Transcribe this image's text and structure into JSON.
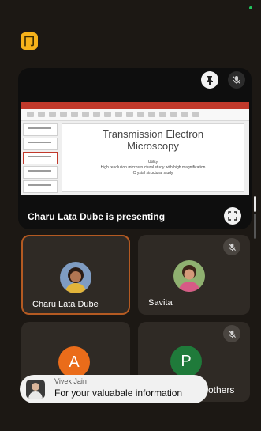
{
  "header": {
    "status_icon": "green-dot",
    "app_icon_glyph": "冂",
    "accent": "#f6b21b"
  },
  "presentation": {
    "presenter_label": "Charu Lata Dube is presenting",
    "slide_title": "Transmission Electron Microscopy",
    "slide_title_line1": "Transmission Electron",
    "slide_title_line2": "Microscopy",
    "slide_bullets": [
      "Utility",
      "High resolution microstructural study with high magnification",
      "Crystal structural study"
    ]
  },
  "participants": [
    {
      "name": "Charu Lata Dube",
      "muted": false,
      "active": true,
      "avatar": "photo"
    },
    {
      "name": "Savita",
      "muted": true,
      "active": false,
      "avatar": "photo"
    },
    {
      "name": "",
      "muted": false,
      "active": false,
      "avatar": "letter",
      "letter": "A",
      "color": "#ea6c1a"
    },
    {
      "name": "",
      "muted": true,
      "active": false,
      "avatar": "letter",
      "letter": "P",
      "color": "#1f7a3a"
    }
  ],
  "others_label": "others",
  "toast": {
    "sender": "Vivek Jain",
    "message": "For your valuabale information"
  }
}
